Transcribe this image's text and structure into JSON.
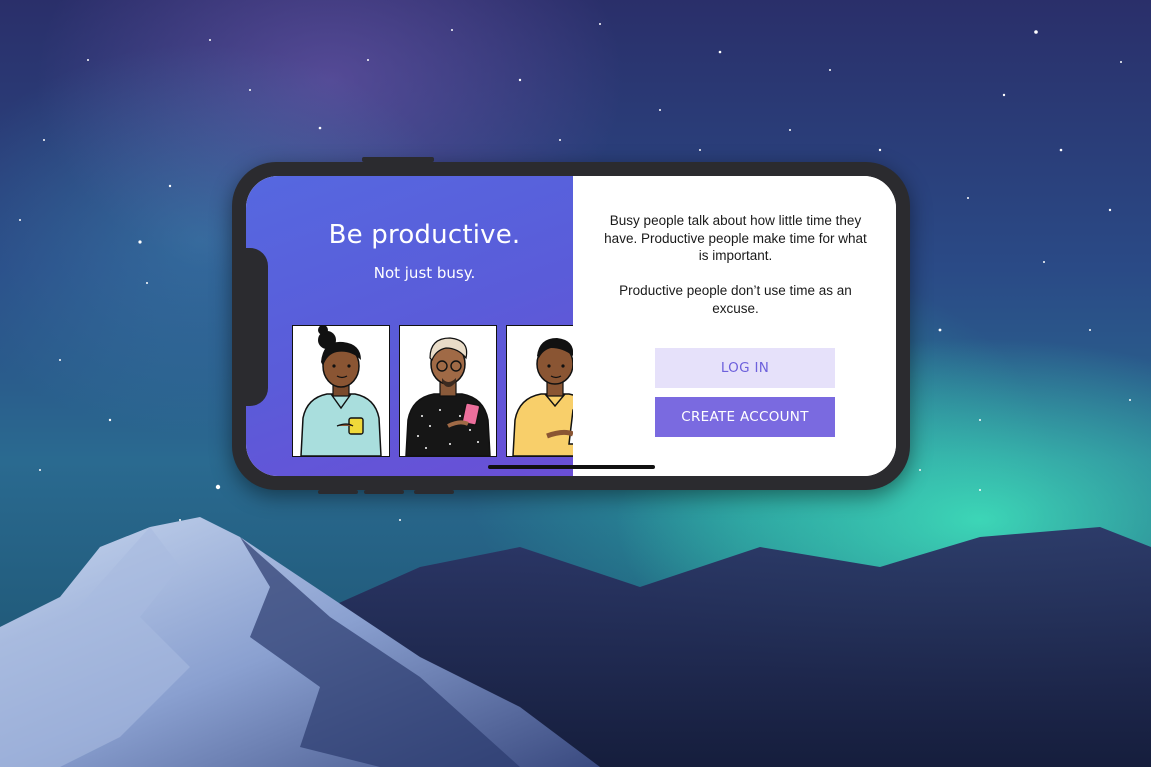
{
  "app": {
    "headline": "Be productive.",
    "subheadline": "Not just busy."
  },
  "intro": {
    "paragraph_1": "Busy people talk about how little time they have. Productive people make time for what is important.",
    "paragraph_2": "Productive people don’t use time as an excuse."
  },
  "actions": {
    "login_label": "LOG IN",
    "create_account_label": "CREATE ACCOUNT"
  },
  "colors": {
    "panel_gradient_start": "#5668e0",
    "panel_gradient_end": "#6a4fd6",
    "login_bg": "#e6e1fa",
    "login_text": "#6e61dc",
    "create_bg": "#7a6ae0",
    "phone_frame": "#2b2b2f"
  },
  "illustrations": [
    "woman-with-mug-illustration",
    "man-with-phone-illustration",
    "man-with-laptop-illustration"
  ]
}
